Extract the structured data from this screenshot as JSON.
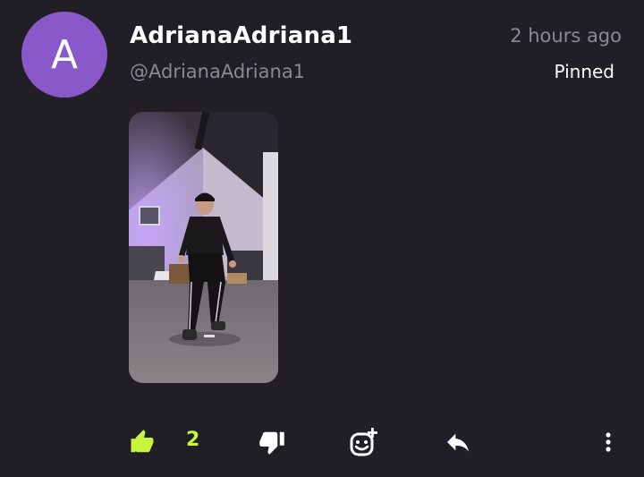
{
  "post": {
    "avatar_letter": "A",
    "display_name": "AdrianaAdriana1",
    "handle": "@AdrianaAdriana1",
    "timestamp": "2 hours ago",
    "pinned_label": "Pinned"
  },
  "actions": {
    "like_count": "2",
    "like_icon": "thumbs-up-icon",
    "dislike_icon": "thumbs-down-icon",
    "reaction_icon": "add-reaction-icon",
    "reply_icon": "reply-icon",
    "more_icon": "more-vertical-icon"
  },
  "colors": {
    "background": "#211e26",
    "avatar": "#8a59c9",
    "accent": "#c8f53b",
    "muted_text": "#8b8794"
  }
}
